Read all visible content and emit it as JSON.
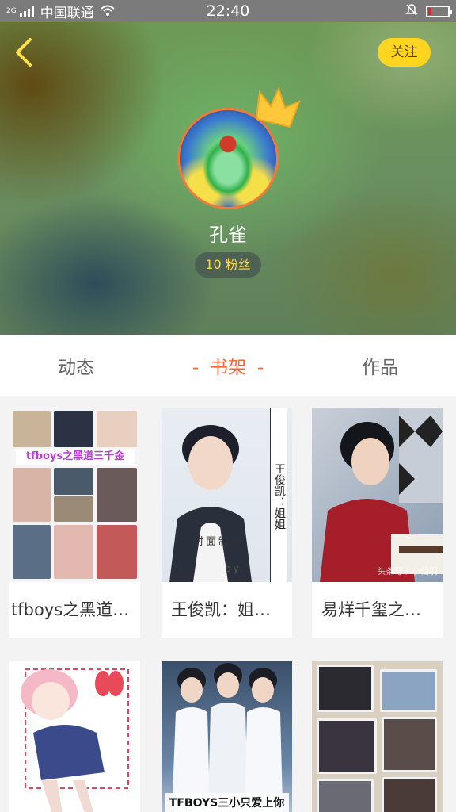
{
  "status_bar": {
    "signal_label": "2G",
    "carrier": "中国联通",
    "time": "22:40",
    "icons": [
      "signal-icon",
      "wifi-icon",
      "mute-bell-icon",
      "battery-icon"
    ],
    "battery_level": 0.15,
    "battery_color": "#e8202a"
  },
  "header": {
    "back_icon": "chevron-left-icon",
    "follow_label": "关注",
    "nickname": "孔雀",
    "fans_label": "10 粉丝",
    "accent_color": "#ffd520"
  },
  "tabs": [
    {
      "label": "动态",
      "active": false
    },
    {
      "label": "书架",
      "active": true,
      "dash": "-"
    },
    {
      "label": "作品",
      "active": false
    }
  ],
  "books": [
    {
      "title": "tfboys之黑道…",
      "cover_text": "tfboys之黑道三千金"
    },
    {
      "title": "王俊凯：姐…",
      "cover_text": "王俊凯：姐姐",
      "cover_stamp": "封面制作",
      "cover_by": "by"
    },
    {
      "title": "易烊千玺之…",
      "cover_watermark": "头条号 / 小仙羽"
    },
    {
      "title": ""
    },
    {
      "title": "",
      "cover_text": "TFBOYS三小只爱上你"
    },
    {
      "title": ""
    }
  ]
}
